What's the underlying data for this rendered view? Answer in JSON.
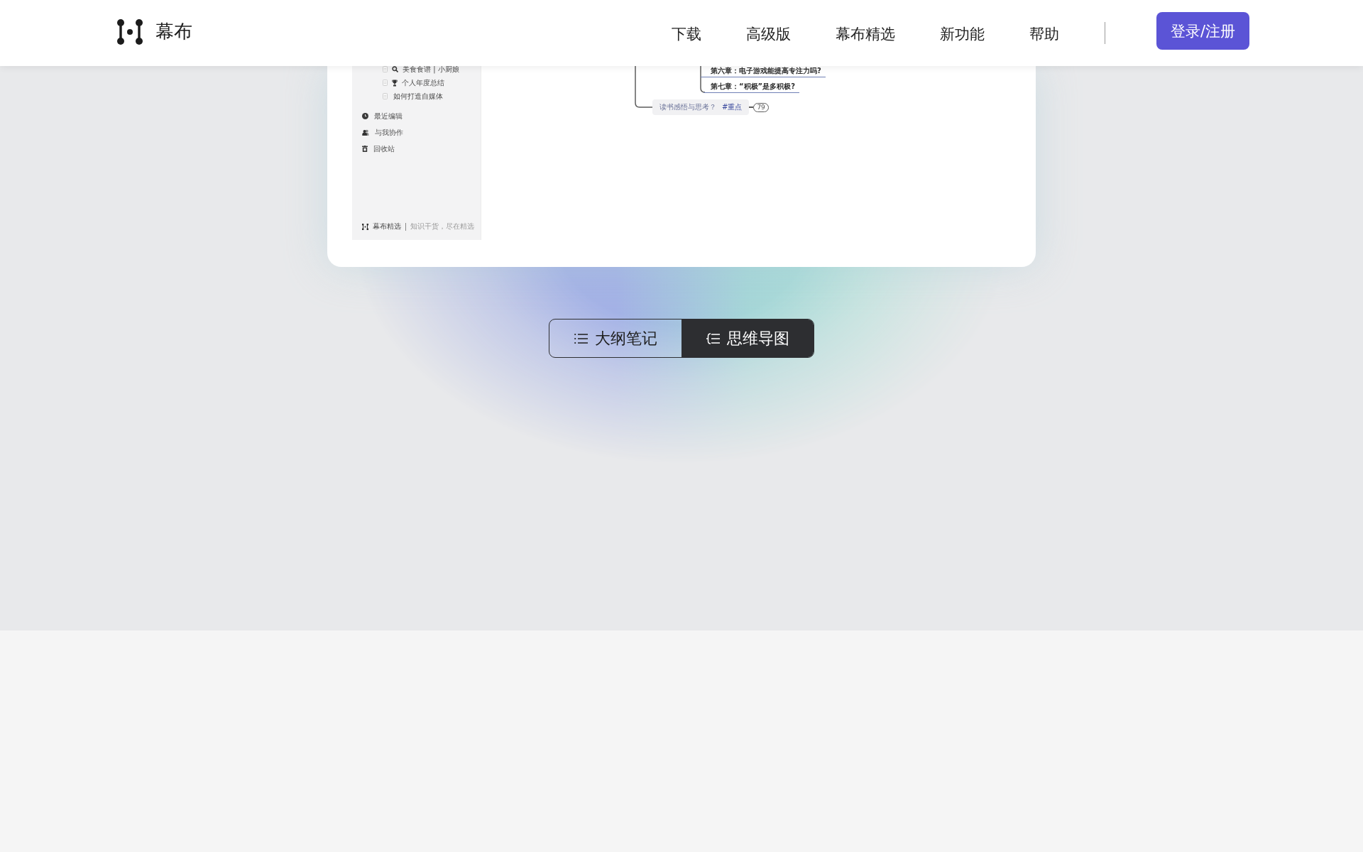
{
  "header": {
    "logo_text": "幕布",
    "nav": [
      "下载",
      "高级版",
      "幕布精选",
      "新功能",
      "帮助"
    ],
    "login_button": "登录/注册"
  },
  "preview": {
    "sidebar": {
      "documents": [
        {
          "title": "美食食谱 | 小厨娘",
          "kind": "magnifier"
        },
        {
          "title": "个人年度总结",
          "kind": "trophy"
        },
        {
          "title": "如何打造自媒体",
          "kind": "plain"
        }
      ],
      "menu": [
        {
          "label": "最近编辑",
          "kind": "clock"
        },
        {
          "label": "与我协作",
          "kind": "people"
        },
        {
          "label": "回收站",
          "kind": "trash"
        }
      ],
      "footer": {
        "brand": "幕布精选",
        "slogan": "知识干货，尽在精选"
      }
    },
    "mindmap": {
      "branches": [
        "第六章：电子游戏能提高专注力吗?",
        "第七章：“积极”是多积极?"
      ],
      "node": {
        "text": "读书感悟与思考？",
        "tag": "#重点",
        "count": "79"
      }
    }
  },
  "view_switch": [
    {
      "label": "大纲笔记",
      "kind": "outline",
      "selected": false
    },
    {
      "label": "思维导图",
      "kind": "mindmap",
      "selected": true
    }
  ]
}
